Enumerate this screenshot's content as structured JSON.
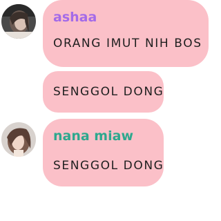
{
  "messages": [
    {
      "sender": "ashaa",
      "text": "ORANG IMUT NIH BOS",
      "name_color": "#a46be8"
    },
    {
      "sender": "",
      "text": "SENGGOL DONG",
      "name_color": ""
    },
    {
      "sender": "nana miaw",
      "text": "SENGGOL DONG",
      "name_color": "#2ea88e"
    }
  ],
  "colors": {
    "bubble_bg": "#fbc0c8",
    "text": "#1f1f1f"
  },
  "icons": [
    "avatar-ashaa",
    "avatar-nana-miaw"
  ]
}
